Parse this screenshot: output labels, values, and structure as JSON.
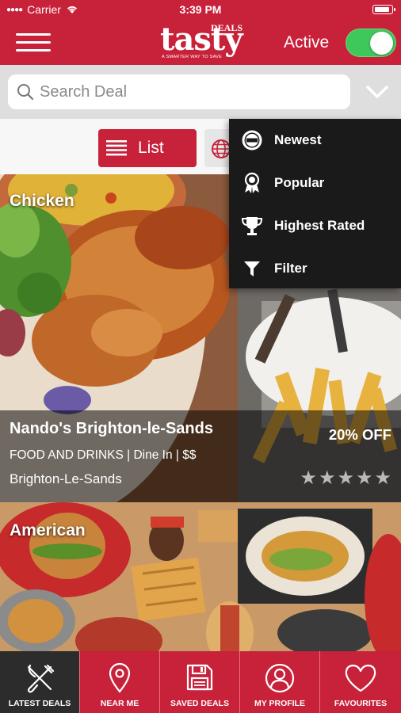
{
  "status_bar": {
    "carrier": "Carrier",
    "time": "3:39 PM"
  },
  "header": {
    "logo": {
      "word": "tasty",
      "deals": "DEALS",
      "tagline": "A SMARTER WAY TO SAVE"
    },
    "active_label": "Active",
    "active_toggle_on": true,
    "toggle_color": "#3ec85a"
  },
  "search": {
    "placeholder": "Search Deal",
    "value": ""
  },
  "view": {
    "list_label": "List",
    "selected": "list"
  },
  "sort_menu": {
    "items": [
      {
        "label": "Newest",
        "icon": "new-badge-icon"
      },
      {
        "label": "Popular",
        "icon": "award-ribbon-icon"
      },
      {
        "label": "Highest Rated",
        "icon": "trophy-icon"
      },
      {
        "label": "Filter",
        "icon": "funnel-icon"
      }
    ]
  },
  "deals": [
    {
      "category": "Chicken",
      "name": "Nando's Brighton-le-Sands",
      "meta": "FOOD AND DRINKS | Dine In | $$",
      "location": "Brighton-Le-Sands",
      "offer": "20% OFF",
      "rating": 0,
      "rating_max": 5
    },
    {
      "category": "American"
    }
  ],
  "tabs": [
    {
      "label": "LATEST DEALS",
      "icon": "fork-knife-icon",
      "selected": true
    },
    {
      "label": "NEAR ME",
      "icon": "map-pin-icon",
      "selected": false
    },
    {
      "label": "SAVED DEALS",
      "icon": "floppy-disk-icon",
      "selected": false
    },
    {
      "label": "MY PROFILE",
      "icon": "user-profile-icon",
      "selected": false
    },
    {
      "label": "FAVOURITES",
      "icon": "heart-icon",
      "selected": false
    }
  ],
  "colors": {
    "brand_red": "#c8213a",
    "dropdown_bg": "#1a1a1a",
    "tab_selected_bg": "#2c2c2c",
    "star_color": "#b9b9b9"
  }
}
